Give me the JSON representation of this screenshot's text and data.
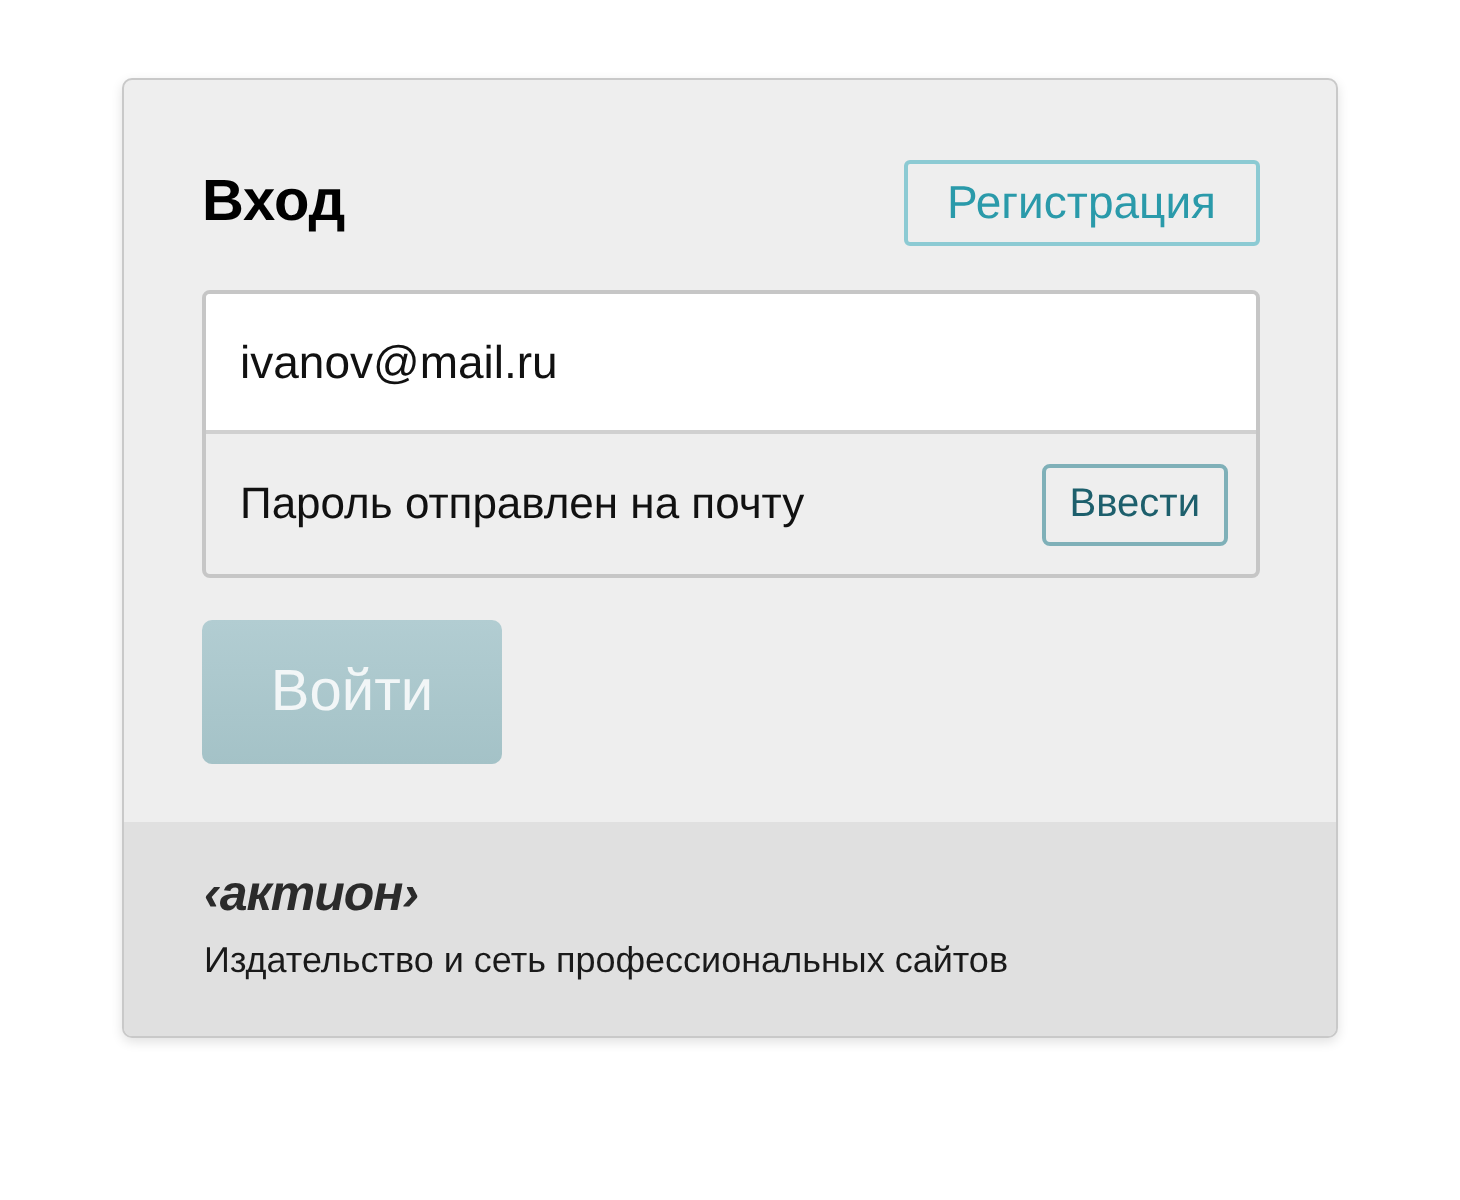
{
  "title": "Вход",
  "register_button": "Регистрация",
  "email_field": {
    "value": "ivanov@mail.ru"
  },
  "password_notice": "Пароль отправлен на почту",
  "enter_button": "Ввести",
  "login_button": {
    "label": "Войти",
    "disabled": true
  },
  "footer": {
    "logo": "‹актион›",
    "tagline": "Издательство и сеть профессиональных сайтов"
  }
}
